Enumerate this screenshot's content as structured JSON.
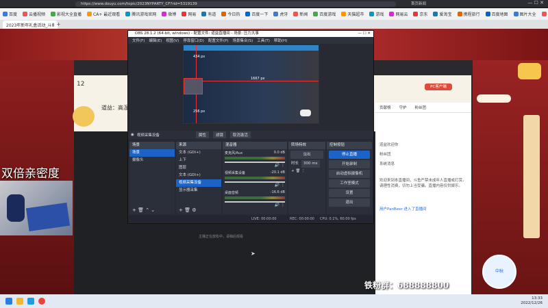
{
  "browser": {
    "url": "https://www.douyu.com/topic/2023NYPARTY_CF?rid=5319139",
    "window_title": "首页新闻",
    "tab_title": "2023年新年礼盒活动_斗鱼直播平台",
    "bookmarks": [
      "百度",
      "云播视频",
      "影视大全直播",
      "CA+ 最近观看",
      "腾讯游戏官网",
      "微博",
      "网易",
      "有道",
      "今日热",
      "百度一下",
      "虎牙",
      "新闻",
      "百度游戏",
      "天猫超市",
      "游戏",
      "网易云",
      "京东",
      "爱淘宝",
      "携程旅行",
      "百度地图",
      "图片大全",
      "小游戏"
    ]
  },
  "obs": {
    "title": "OBS 28.1.2 (64-bit, windows) - 配置文件: 道益直播间 - 场景: 压力大事",
    "menu": [
      "文件(F)",
      "编辑(E)",
      "视图(V)",
      "停靠窗口(D)",
      "配置文件(P)",
      "场景集合(S)",
      "工具(T)",
      "帮助(H)"
    ],
    "source_bar": {
      "current": "视频采集设备",
      "props": "属性",
      "filters": "滤镜",
      "deactivate": "取消激活"
    },
    "scenes": {
      "title": "场景",
      "items": [
        "场景",
        "摄像头"
      ]
    },
    "sources": {
      "title": "来源",
      "items": [
        "文本 (GDI+)",
        "上下",
        "图层",
        "文本 (GDI+)",
        "视频采集设备",
        "显示器采集"
      ]
    },
    "mixer": {
      "title": "混音器",
      "channels": [
        {
          "name": "麦克风/Aux",
          "db": "0.0 dB"
        },
        {
          "name": "视频采集设备",
          "db": "-20.1 dB"
        },
        {
          "name": "桌面音频",
          "db": "-16.6 dB"
        }
      ]
    },
    "transitions": {
      "title": "转场特效",
      "type": "淡出",
      "duration_label": "时长",
      "duration": "300 ms"
    },
    "controls": {
      "title": "控制按钮",
      "buttons": [
        "停止直播",
        "开始录制",
        "启动虚拟摄像机",
        "工作室模式",
        "设置",
        "退出"
      ]
    },
    "preview_labels": {
      "top": "434 px",
      "right": "1667 px",
      "bottom": "256 px"
    },
    "status": {
      "live": "LIVE: 00:00:00",
      "rec": "REC: 00:00:00",
      "cpu": "CPU: 0.1%, 60.00 fps"
    }
  },
  "stream": {
    "host": "道益：高温",
    "count": "12",
    "sidebar_btn": "PC客户端",
    "right_tabs": [
      "贡献榜",
      "守护",
      "粉丝团"
    ],
    "video_hint": "主播正在放松中，请稍后观看"
  },
  "overlays": {
    "big_text": "双倍亲密度",
    "fan_group": "铁粉群：688888800",
    "mascot": "中秋"
  },
  "chat": {
    "lines": [
      "欢迎来到本直播间。斗鱼严禁未成年人直播或打赏。",
      "道益欢迎你",
      "粉丝团",
      "系统消息",
      "欢迎来到本直播间，斗鱼严禁未成年人直播或打赏。请理性消费，切勿上当受骗。直播内容仅供娱乐。"
    ],
    "footer": "用户PanBeer 进入了直播间"
  },
  "taskbar": {
    "time": "13:33",
    "date": "2022/12/26"
  }
}
